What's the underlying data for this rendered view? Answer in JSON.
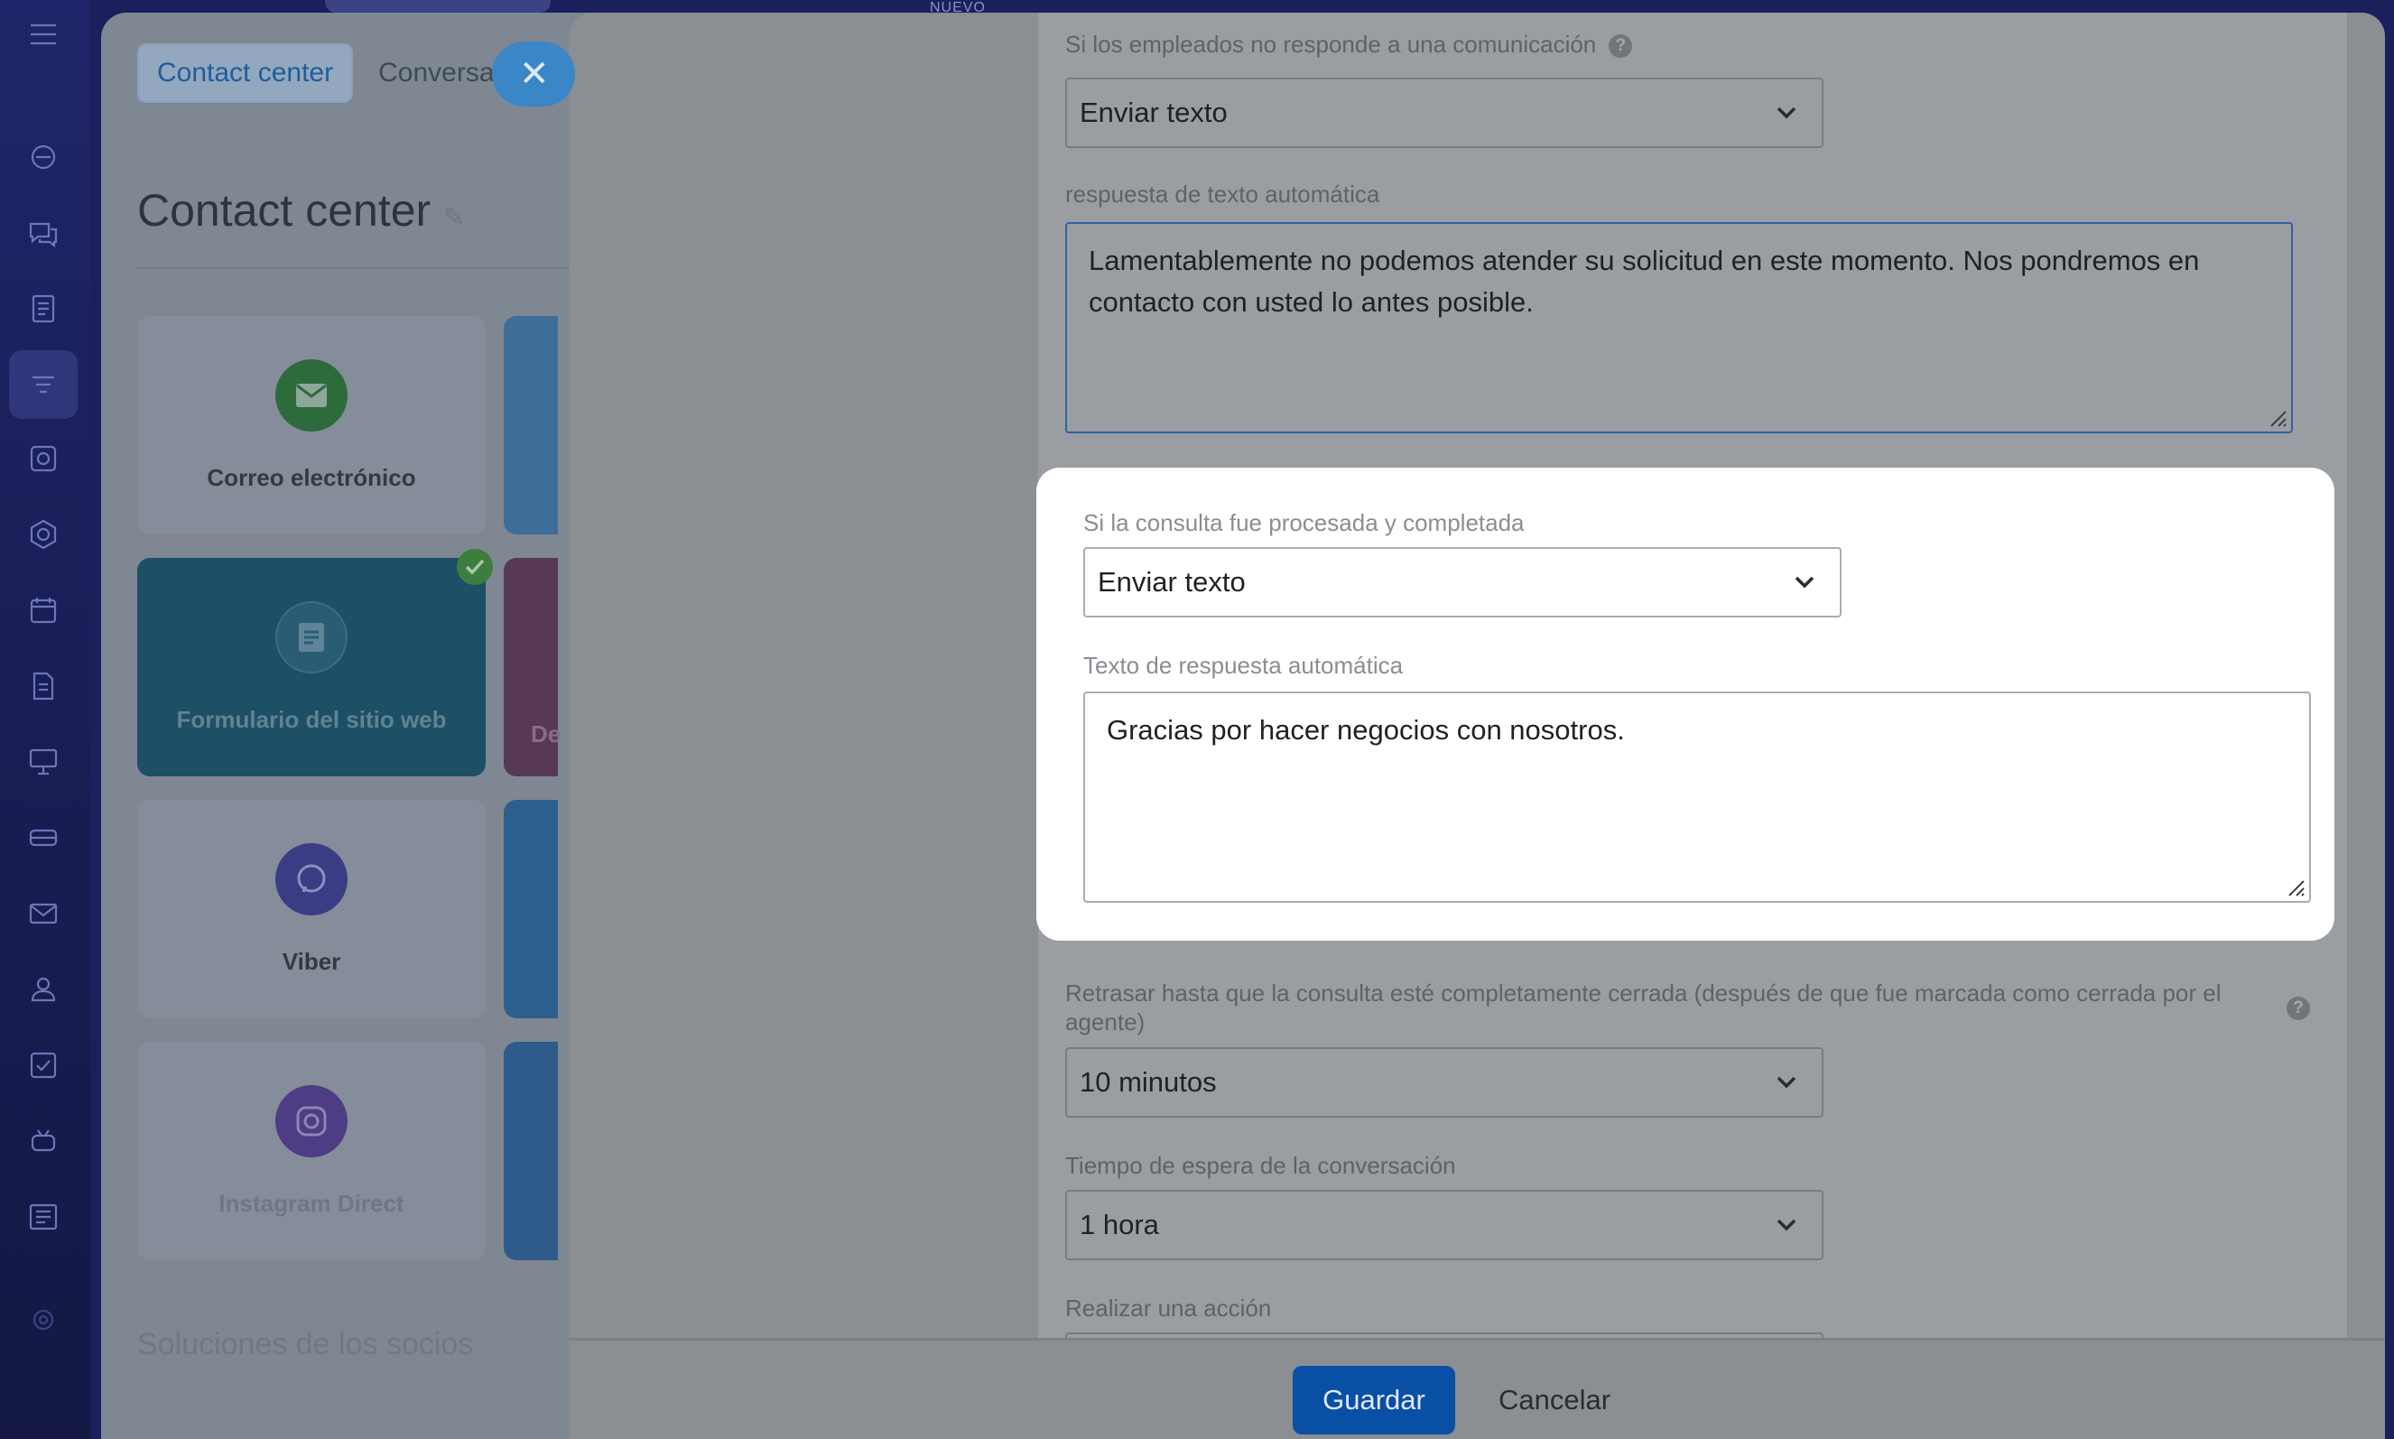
{
  "sidebar": {
    "icons": [
      "menu-icon",
      "sales-icon",
      "chat-icon",
      "feed-icon",
      "contact-center-icon",
      "tasks-icon",
      "hexagon-icon",
      "calendar-icon",
      "documents-icon",
      "presentation-icon",
      "sites-icon",
      "mail-icon",
      "employees-icon",
      "checklist-icon",
      "robot-icon",
      "list-icon",
      "settings-icon"
    ]
  },
  "top": {
    "new_badge": "NUEVO"
  },
  "background": {
    "tabs": [
      "Contact center",
      "Conversa"
    ],
    "title": "Contact center",
    "tiles": [
      {
        "label": "Correo electrónico",
        "icon": "envelope-icon"
      },
      {
        "label": "Formulario del sitio web",
        "icon": "form-icon"
      },
      {
        "label": "Viber",
        "icon": "viber-icon"
      },
      {
        "label": "Instagram Direct",
        "icon": "instagram-icon"
      }
    ],
    "partial_tile_label": "De",
    "footer_text": "Soluciones de los socios"
  },
  "form": {
    "no_response": {
      "label": "Si los empleados no responde a una comunicación",
      "value": "Enviar texto"
    },
    "auto_text_1": {
      "label": "respuesta de texto automática",
      "value": "Lamentablemente no podemos atender su solicitud en este momento. Nos pondremos en contacto con usted lo antes posible."
    },
    "completed": {
      "label": "Si la consulta fue procesada y completada",
      "value": "Enviar texto"
    },
    "auto_text_2": {
      "label": "Texto de respuesta automática",
      "value": "Gracias por hacer negocios con nosotros."
    },
    "delay": {
      "label": "Retrasar hasta que la consulta esté completamente cerrada (después de que fue marcada como cerrada por el agente)",
      "value": "10 minutos"
    },
    "wait_time": {
      "label": "Tiempo de espera de la conversación",
      "value": "1 hora"
    },
    "action": {
      "label": "Realizar una acción"
    }
  },
  "footer": {
    "save_label": "Guardar",
    "cancel_label": "Cancelar"
  },
  "colors": {
    "accent": "#0a4fa6",
    "highlight_bg": "#ffffff",
    "overlay": "#8b8e92"
  }
}
